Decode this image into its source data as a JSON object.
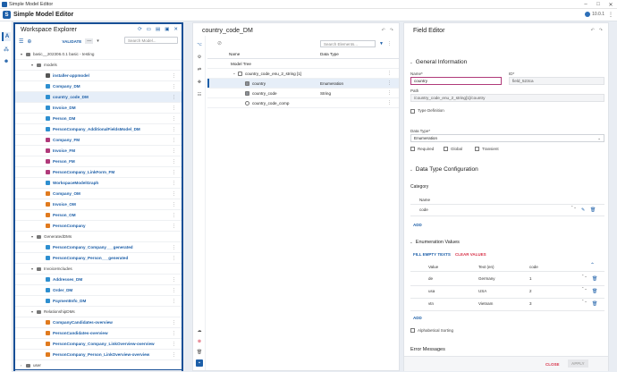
{
  "window": {
    "title": "Simple Model Editor"
  },
  "app": {
    "name": "Simple Model Editor",
    "version": "10.0.1"
  },
  "explorer": {
    "title": "Workspace Explorer",
    "validate_label": "VALIDATE",
    "search_placeholder": "Search Model...",
    "nodes": [
      {
        "label": "basic__202306.0.1 basic - testing",
        "depth": 1,
        "kind": "root",
        "expanded": true
      },
      {
        "label": "models",
        "depth": 2,
        "kind": "folder",
        "expanded": true
      },
      {
        "label": "installer-appmodel",
        "depth": 3,
        "kind": "app"
      },
      {
        "label": "Company_DM",
        "depth": 3,
        "kind": "dm"
      },
      {
        "label": "country_code_DM",
        "depth": 3,
        "kind": "dm",
        "selected": true
      },
      {
        "label": "Invoice_DM",
        "depth": 3,
        "kind": "dm"
      },
      {
        "label": "Person_DM",
        "depth": 3,
        "kind": "dm"
      },
      {
        "label": "PersonCompany_AdditionalFieldsModel_DM",
        "depth": 3,
        "kind": "dm"
      },
      {
        "label": "Company_FM",
        "depth": 3,
        "kind": "fm"
      },
      {
        "label": "Invoice_FM",
        "depth": 3,
        "kind": "fm"
      },
      {
        "label": "Person_FM",
        "depth": 3,
        "kind": "fm"
      },
      {
        "label": "PersonCompany_LinkForm_FM",
        "depth": 3,
        "kind": "fm"
      },
      {
        "label": "WorkspaceModelGraph",
        "depth": 3,
        "kind": "graph"
      },
      {
        "label": "Company_OM",
        "depth": 3,
        "kind": "om"
      },
      {
        "label": "Invoice_OM",
        "depth": 3,
        "kind": "om"
      },
      {
        "label": "Person_OM",
        "depth": 3,
        "kind": "om"
      },
      {
        "label": "PersonCompany",
        "depth": 3,
        "kind": "om"
      },
      {
        "label": "GeneratedDMs",
        "depth": 2,
        "kind": "folder",
        "expanded": true
      },
      {
        "label": "PersonCompany_Company___generated",
        "depth": 3,
        "kind": "dm"
      },
      {
        "label": "PersonCompany_Person___generated",
        "depth": 3,
        "kind": "dm"
      },
      {
        "label": "InvoiceIncludes",
        "depth": 2,
        "kind": "folder",
        "expanded": true
      },
      {
        "label": "Addresses_DM",
        "depth": 3,
        "kind": "dm"
      },
      {
        "label": "Order_DM",
        "depth": 3,
        "kind": "dm"
      },
      {
        "label": "PaymentInfo_DM",
        "depth": 3,
        "kind": "dm"
      },
      {
        "label": "RelationshipDMs",
        "depth": 2,
        "kind": "folder",
        "expanded": true
      },
      {
        "label": "CompanyCandidates-overview",
        "depth": 3,
        "kind": "ov"
      },
      {
        "label": "PersonCandidates-overview",
        "depth": 3,
        "kind": "ov"
      },
      {
        "label": "PersonCompany_Company_LinkOverview-overview",
        "depth": 3,
        "kind": "ov"
      },
      {
        "label": "PersonCompany_Person_LinkOverview-overview",
        "depth": 3,
        "kind": "ov"
      },
      {
        "label": "user",
        "depth": 1,
        "kind": "folder",
        "expanded": false
      }
    ]
  },
  "model": {
    "title": "country_code_DM",
    "search_placeholder": "Search Elements...",
    "col_name": "Name",
    "col_type": "Data Type",
    "rows": [
      {
        "name": "Model Tree",
        "type": "",
        "indent": 0,
        "icon": ""
      },
      {
        "name": "country_code_enu_2_string [1]",
        "type": "",
        "indent": 1,
        "icon": "group"
      },
      {
        "name": "country",
        "type": "Enumeration",
        "indent": 2,
        "icon": "field",
        "selected": true
      },
      {
        "name": "country_code",
        "type": "String",
        "indent": 2,
        "icon": "field"
      },
      {
        "name": "country_code_comp",
        "type": "",
        "indent": 2,
        "icon": "comp"
      }
    ]
  },
  "editor": {
    "title": "Field Editor",
    "general_title": "General Information",
    "name_label": "Name*",
    "name_value": "country",
    "id_label": "ID*",
    "id_value": "field_523ca",
    "path_label": "Path",
    "path_value": "/country_code_enu_2_string[1]/country",
    "type_def_label": "Type Definition",
    "datatype_label": "Data Type*",
    "datatype_value": "Enumeration",
    "required_label": "Required",
    "global_label": "Global",
    "transient_label": "Transient",
    "dtc_title": "Data Type Configuration",
    "category_label": "Category",
    "cat_col": "Name",
    "cat_rows": [
      {
        "name": "code"
      }
    ],
    "add_label": "ADD",
    "enum_title": "Enumeration Values",
    "fill_empty": "FILL EMPTY TEXTS",
    "clear_values": "CLEAR VALUES",
    "enum_cols": [
      "Value",
      "Text (en)",
      "code"
    ],
    "enum_rows": [
      {
        "value": "de",
        "text": "Germany",
        "code": "1"
      },
      {
        "value": "usa",
        "text": "USA",
        "code": "2"
      },
      {
        "value": "vtn",
        "text": "Vietnam",
        "code": "3"
      }
    ],
    "add2_label": "ADD",
    "alpha_label": "Alphabetical Sorting",
    "error_title": "Error Messages",
    "close_label": "CLOSE",
    "apply_label": "APPLY"
  },
  "colors": {
    "accent": "#1d5fa8",
    "selection": "#e6eef8",
    "danger": "#d8344a",
    "highlight_border": "#b03a7a"
  }
}
